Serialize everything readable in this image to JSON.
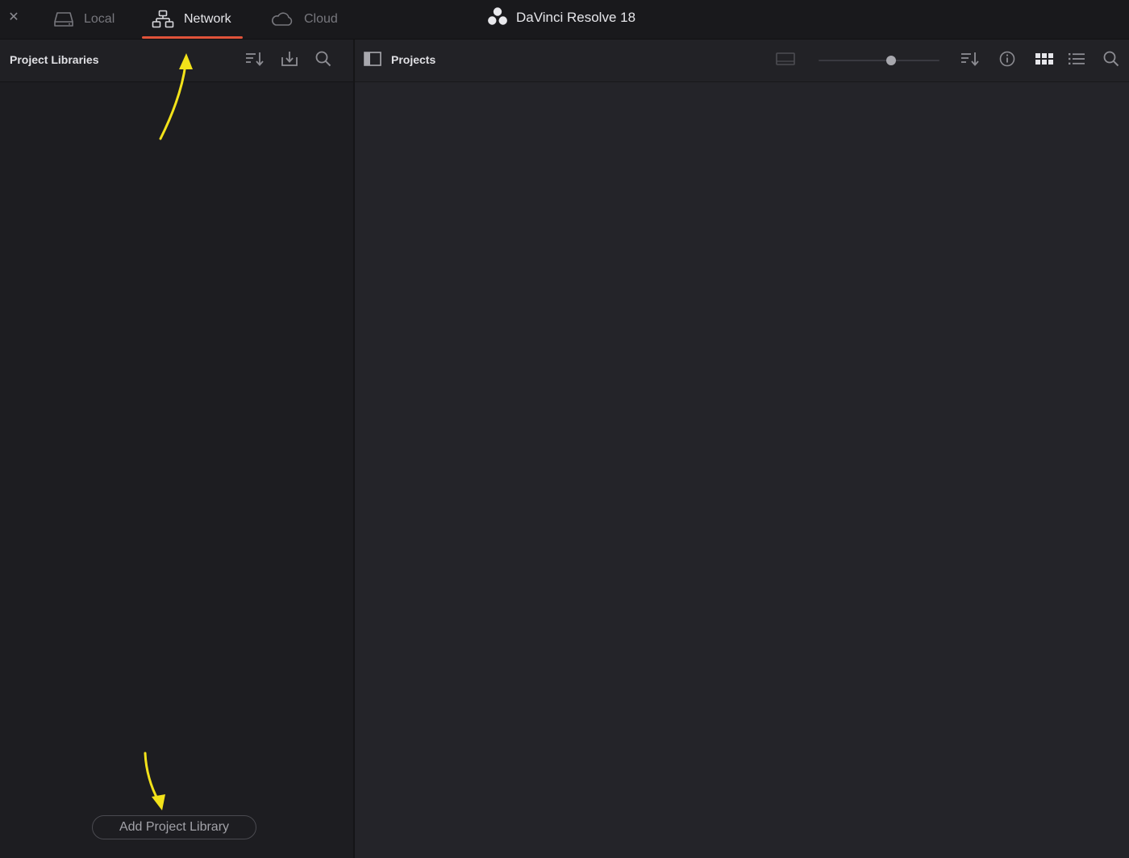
{
  "window": {
    "title": "DaVinci Resolve 18",
    "close_symbol": "✕"
  },
  "tabs": [
    {
      "label": "Local",
      "icon": "hard-drive-icon",
      "active": false
    },
    {
      "label": "Network",
      "icon": "network-icon",
      "active": true
    },
    {
      "label": "Cloud",
      "icon": "cloud-icon",
      "active": false
    }
  ],
  "left_panel": {
    "title": "Project Libraries",
    "add_button_label": "Add Project Library",
    "toolbar_icons": [
      "sort-icon",
      "import-icon",
      "search-icon"
    ]
  },
  "right_panel": {
    "title": "Projects",
    "toolbar_icons": [
      "thumbnail-size-icon",
      "sort-icon",
      "info-icon",
      "grid-view-icon",
      "list-view-icon",
      "search-icon"
    ],
    "zoom_slider_fraction": 0.6
  },
  "colors": {
    "accent": "#e0533a",
    "annotation": "#f2e21a",
    "background": "#1e1e22"
  }
}
